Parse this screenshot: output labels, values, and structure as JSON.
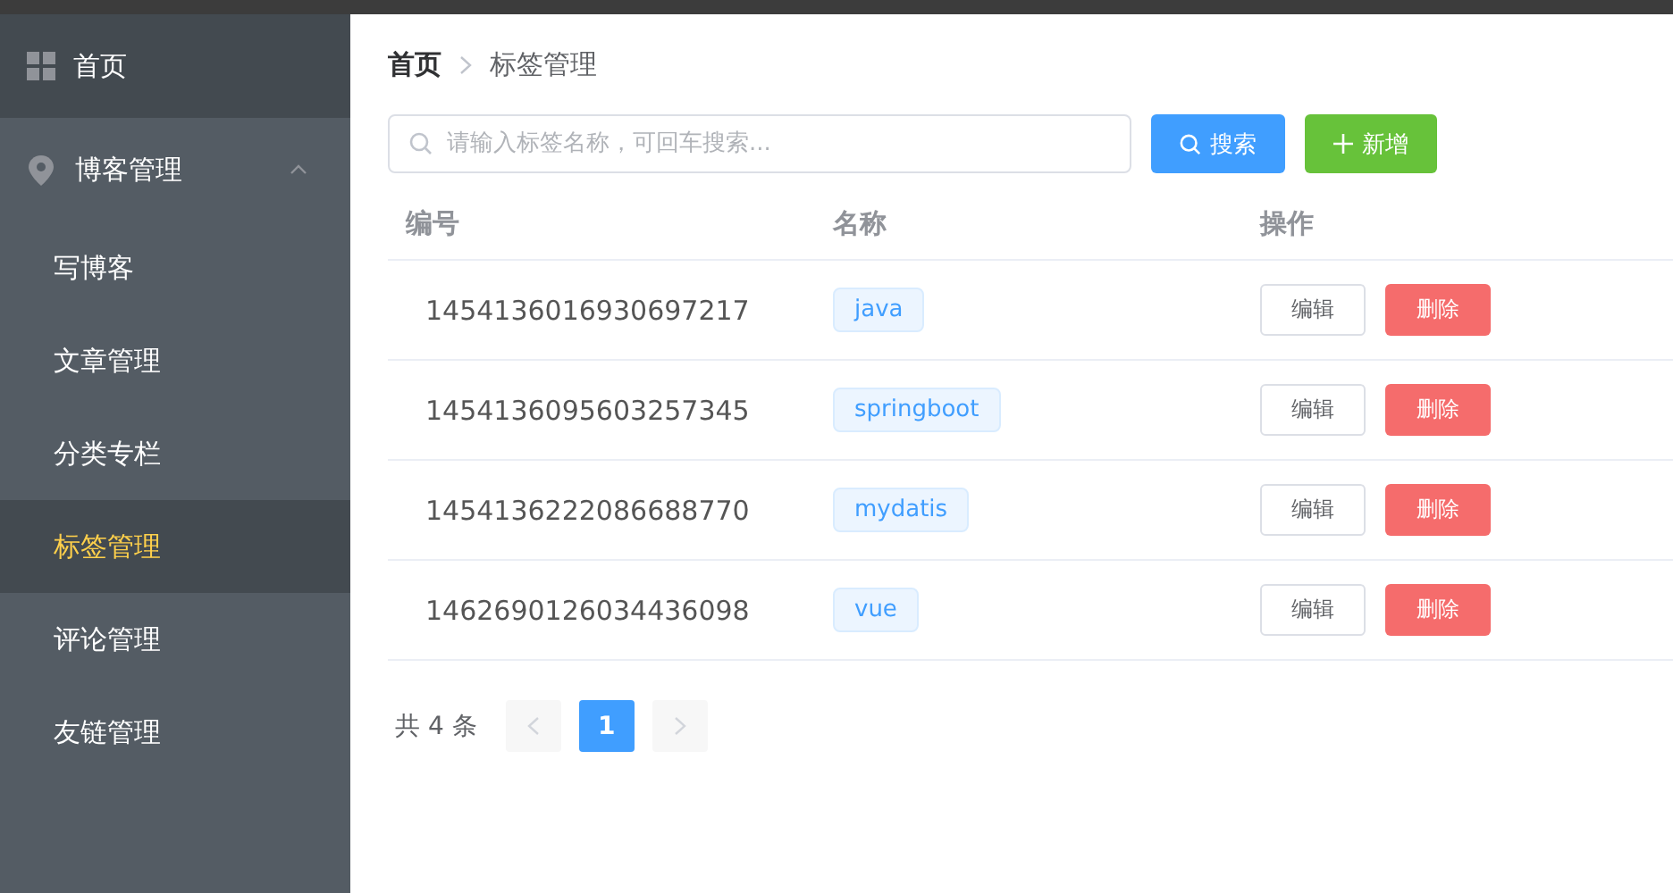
{
  "sidebar": {
    "items": [
      {
        "label": "首页",
        "kind": "home",
        "selected": false
      },
      {
        "label": "博客管理",
        "kind": "group",
        "expanded": true,
        "children": [
          {
            "label": "写博客",
            "selected": false
          },
          {
            "label": "文章管理",
            "selected": false
          },
          {
            "label": "分类专栏",
            "selected": false
          },
          {
            "label": "标签管理",
            "selected": true
          },
          {
            "label": "评论管理",
            "selected": false
          },
          {
            "label": "友链管理",
            "selected": false
          }
        ]
      }
    ]
  },
  "breadcrumb": [
    "首页",
    "标签管理"
  ],
  "search": {
    "placeholder": "请输入标签名称，可回车搜索..."
  },
  "buttons": {
    "search": "搜索",
    "add": "新增"
  },
  "table": {
    "columns": [
      "编号",
      "名称",
      "操作"
    ],
    "rows": [
      {
        "id": "1454136016930697217",
        "name": "java",
        "edit": "编辑",
        "delete": "删除"
      },
      {
        "id": "1454136095603257345",
        "name": "springboot",
        "edit": "编辑",
        "delete": "删除"
      },
      {
        "id": "1454136222086688770",
        "name": "mydatis",
        "edit": "编辑",
        "delete": "删除"
      },
      {
        "id": "1462690126034436098",
        "name": "vue",
        "edit": "编辑",
        "delete": "删除"
      }
    ]
  },
  "pagination": {
    "total": "共 4 条",
    "pages": [
      {
        "label": "1",
        "selected": true
      }
    ],
    "prev_disabled": true,
    "next_disabled": true
  }
}
